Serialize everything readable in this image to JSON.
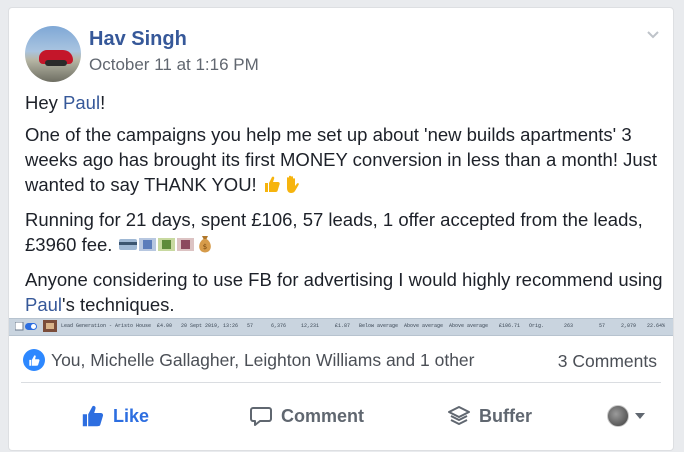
{
  "post": {
    "author": "Hav Singh",
    "timestamp": "October 11 at 1:16 PM",
    "greeting_prefix": "Hey ",
    "greeting_mention": "Paul",
    "greeting_suffix": "!",
    "paragraph1": "One of the campaigns you help me set up about 'new builds apartments' 3 weeks ago has brought its first MONEY conversion in less than a month! Just wanted to say THANK YOU! ",
    "paragraph2": "Running for 21 days, spent £106, 57 leads, 1 offer accepted from the leads, £3960 fee. ",
    "paragraph3_prefix": "Anyone considering to use FB for advertising I would highly recommend using ",
    "paragraph3_mention": "Paul",
    "paragraph3_suffix": "'s techniques."
  },
  "attachment_strip": {
    "campaign": "Lead Generation - Aristo House",
    "cells": [
      "£4.00",
      "20 Sept 2019, 13:26",
      "57",
      "6,376",
      "12,231",
      "£1.87",
      "Below average",
      "Above average",
      "Above average",
      "£106.71",
      "Orig.",
      "263",
      "57",
      "2,079",
      "22.64%"
    ]
  },
  "reactions": {
    "names": "You, Michelle Gallagher, Leighton Williams and 1 other",
    "comments": "3 Comments"
  },
  "actions": {
    "like": "Like",
    "comment": "Comment",
    "buffer": "Buffer"
  },
  "colors": {
    "link": "#365899",
    "like_blue": "#2d6ee0",
    "muted": "#616770"
  },
  "icons": [
    "chevron-down-icon",
    "thumbs-up-icon",
    "waving-hand-icon",
    "money-emoji-icon",
    "money-bag-icon",
    "comment-icon",
    "buffer-icon",
    "caret-down-icon"
  ]
}
